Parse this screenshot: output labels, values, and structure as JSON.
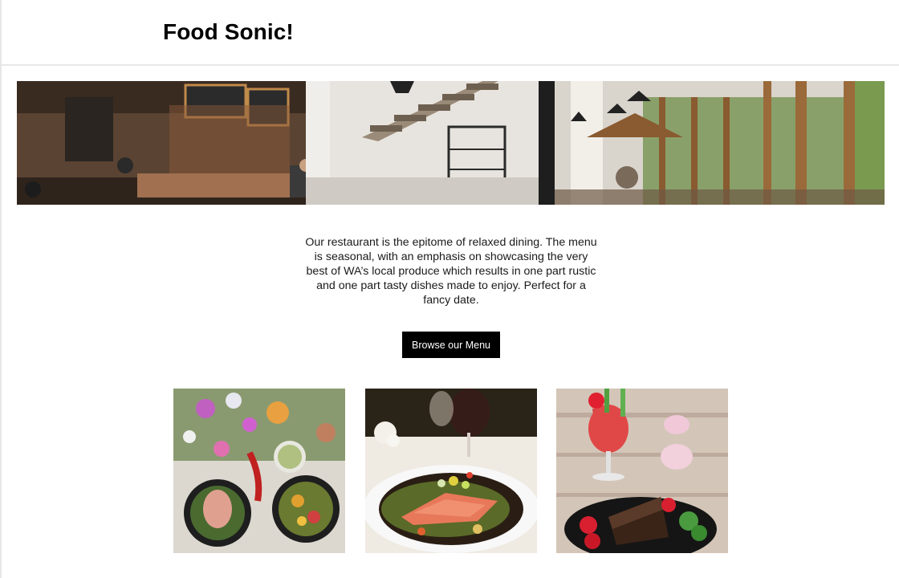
{
  "header": {
    "title": "Food Sonic!"
  },
  "hero": {
    "image": "restaurant-interior-photo"
  },
  "intro": {
    "text": "Our restaurant is the epitome of relaxed dining. The menu is seasonal, with an emphasis on showcasing the very best of WA’s local produce which results in one part rustic and one part tasty dishes made to enjoy. Perfect for a fancy date."
  },
  "cta": {
    "label": "Browse our Menu"
  },
  "gallery": [
    {
      "image": "salad-bowls-with-flowers-photo"
    },
    {
      "image": "salmon-dish-with-wine-photo"
    },
    {
      "image": "chocolate-cake-and-juice-photo"
    }
  ],
  "colors": {
    "button_bg": "#000000",
    "button_text": "#ffffff",
    "header_border": "#e8e8e8"
  }
}
